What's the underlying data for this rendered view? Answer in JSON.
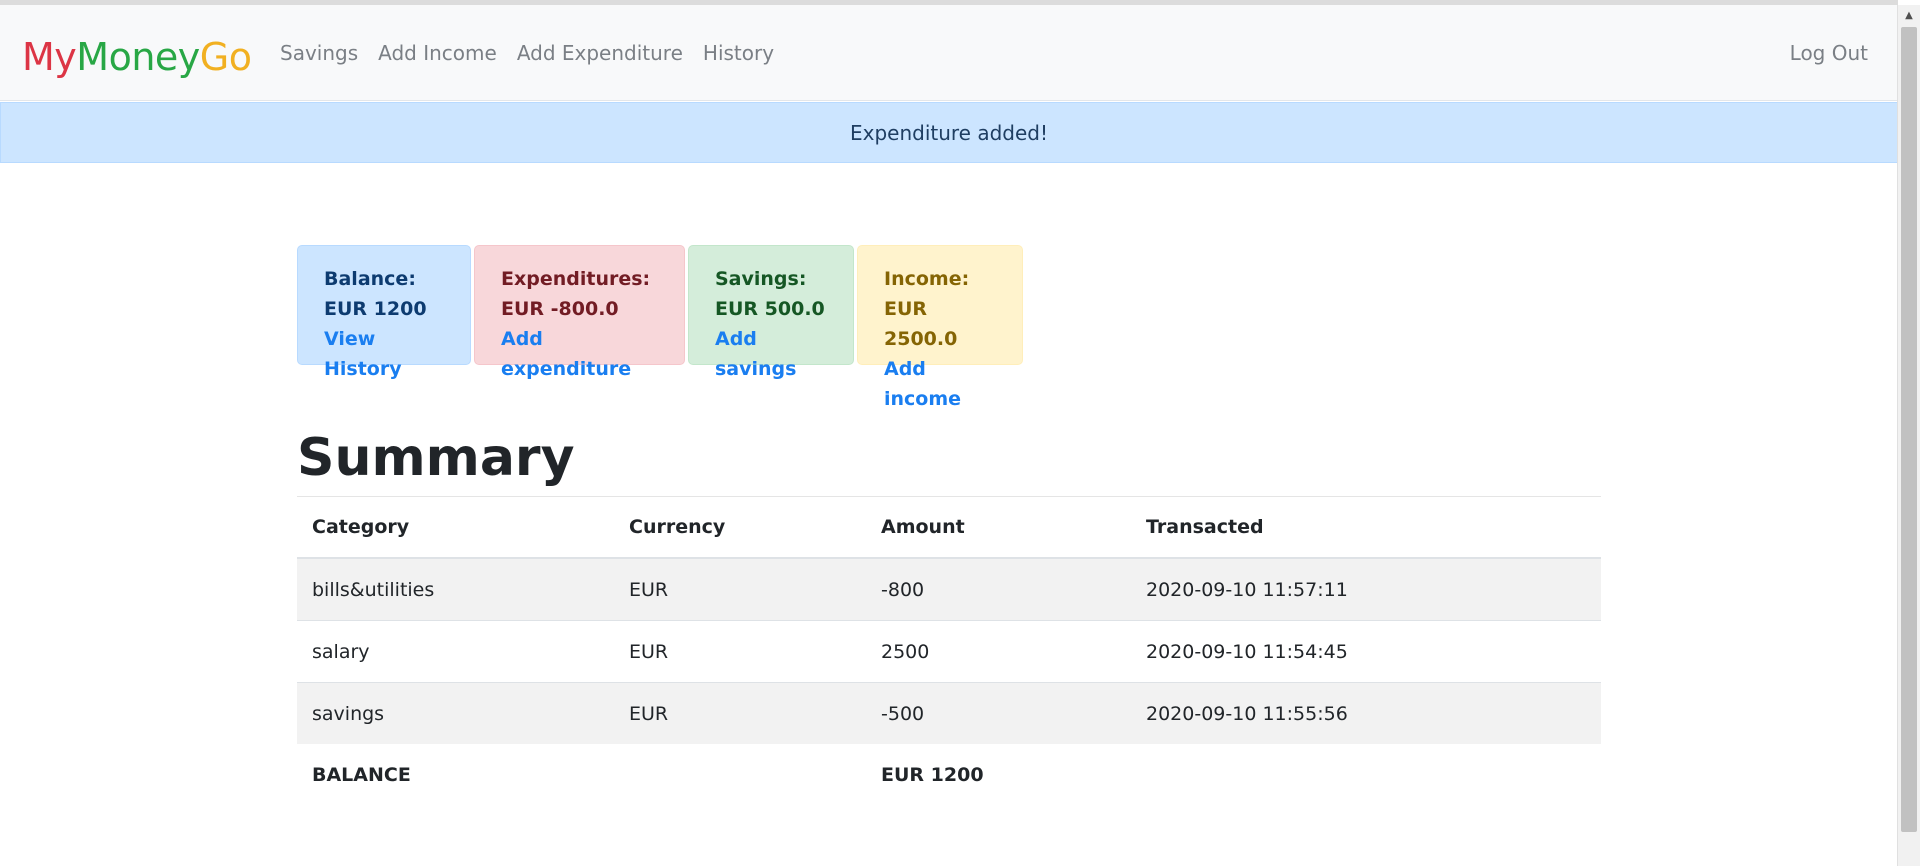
{
  "navbar": {
    "brand": {
      "part1": "My",
      "part2": "Money",
      "part3": "Go"
    },
    "links": [
      "Savings",
      "Add Income",
      "Add Expenditure",
      "History"
    ],
    "logout": "Log Out"
  },
  "alert": {
    "message": "Expenditure added!"
  },
  "cards": {
    "balance": {
      "label": "Balance:",
      "value": "EUR 1200",
      "link": "View History"
    },
    "expenditures": {
      "label": "Expenditures:",
      "value": "EUR -800.0",
      "link": "Add expenditure"
    },
    "savings": {
      "label": "Savings:",
      "value": "EUR 500.0",
      "link": "Add savings"
    },
    "income": {
      "label": "Income:",
      "value": "EUR 2500.0",
      "link": "Add income"
    }
  },
  "summary": {
    "title": "Summary",
    "columns": [
      "Category",
      "Currency",
      "Amount",
      "Transacted"
    ],
    "rows": [
      {
        "category": "bills&utilities",
        "currency": "EUR",
        "amount": "-800",
        "transacted": "2020-09-10 11:57:11"
      },
      {
        "category": "salary",
        "currency": "EUR",
        "amount": "2500",
        "transacted": "2020-09-10 11:54:45"
      },
      {
        "category": "savings",
        "currency": "EUR",
        "amount": "-500",
        "transacted": "2020-09-10 11:55:56"
      }
    ],
    "footer": {
      "label": "BALANCE",
      "value": "EUR 1200"
    }
  },
  "colors": {
    "brand_red": "#dc3545",
    "brand_green": "#28a745",
    "brand_yellow": "#f1b021",
    "link": "#1a7ef0"
  }
}
